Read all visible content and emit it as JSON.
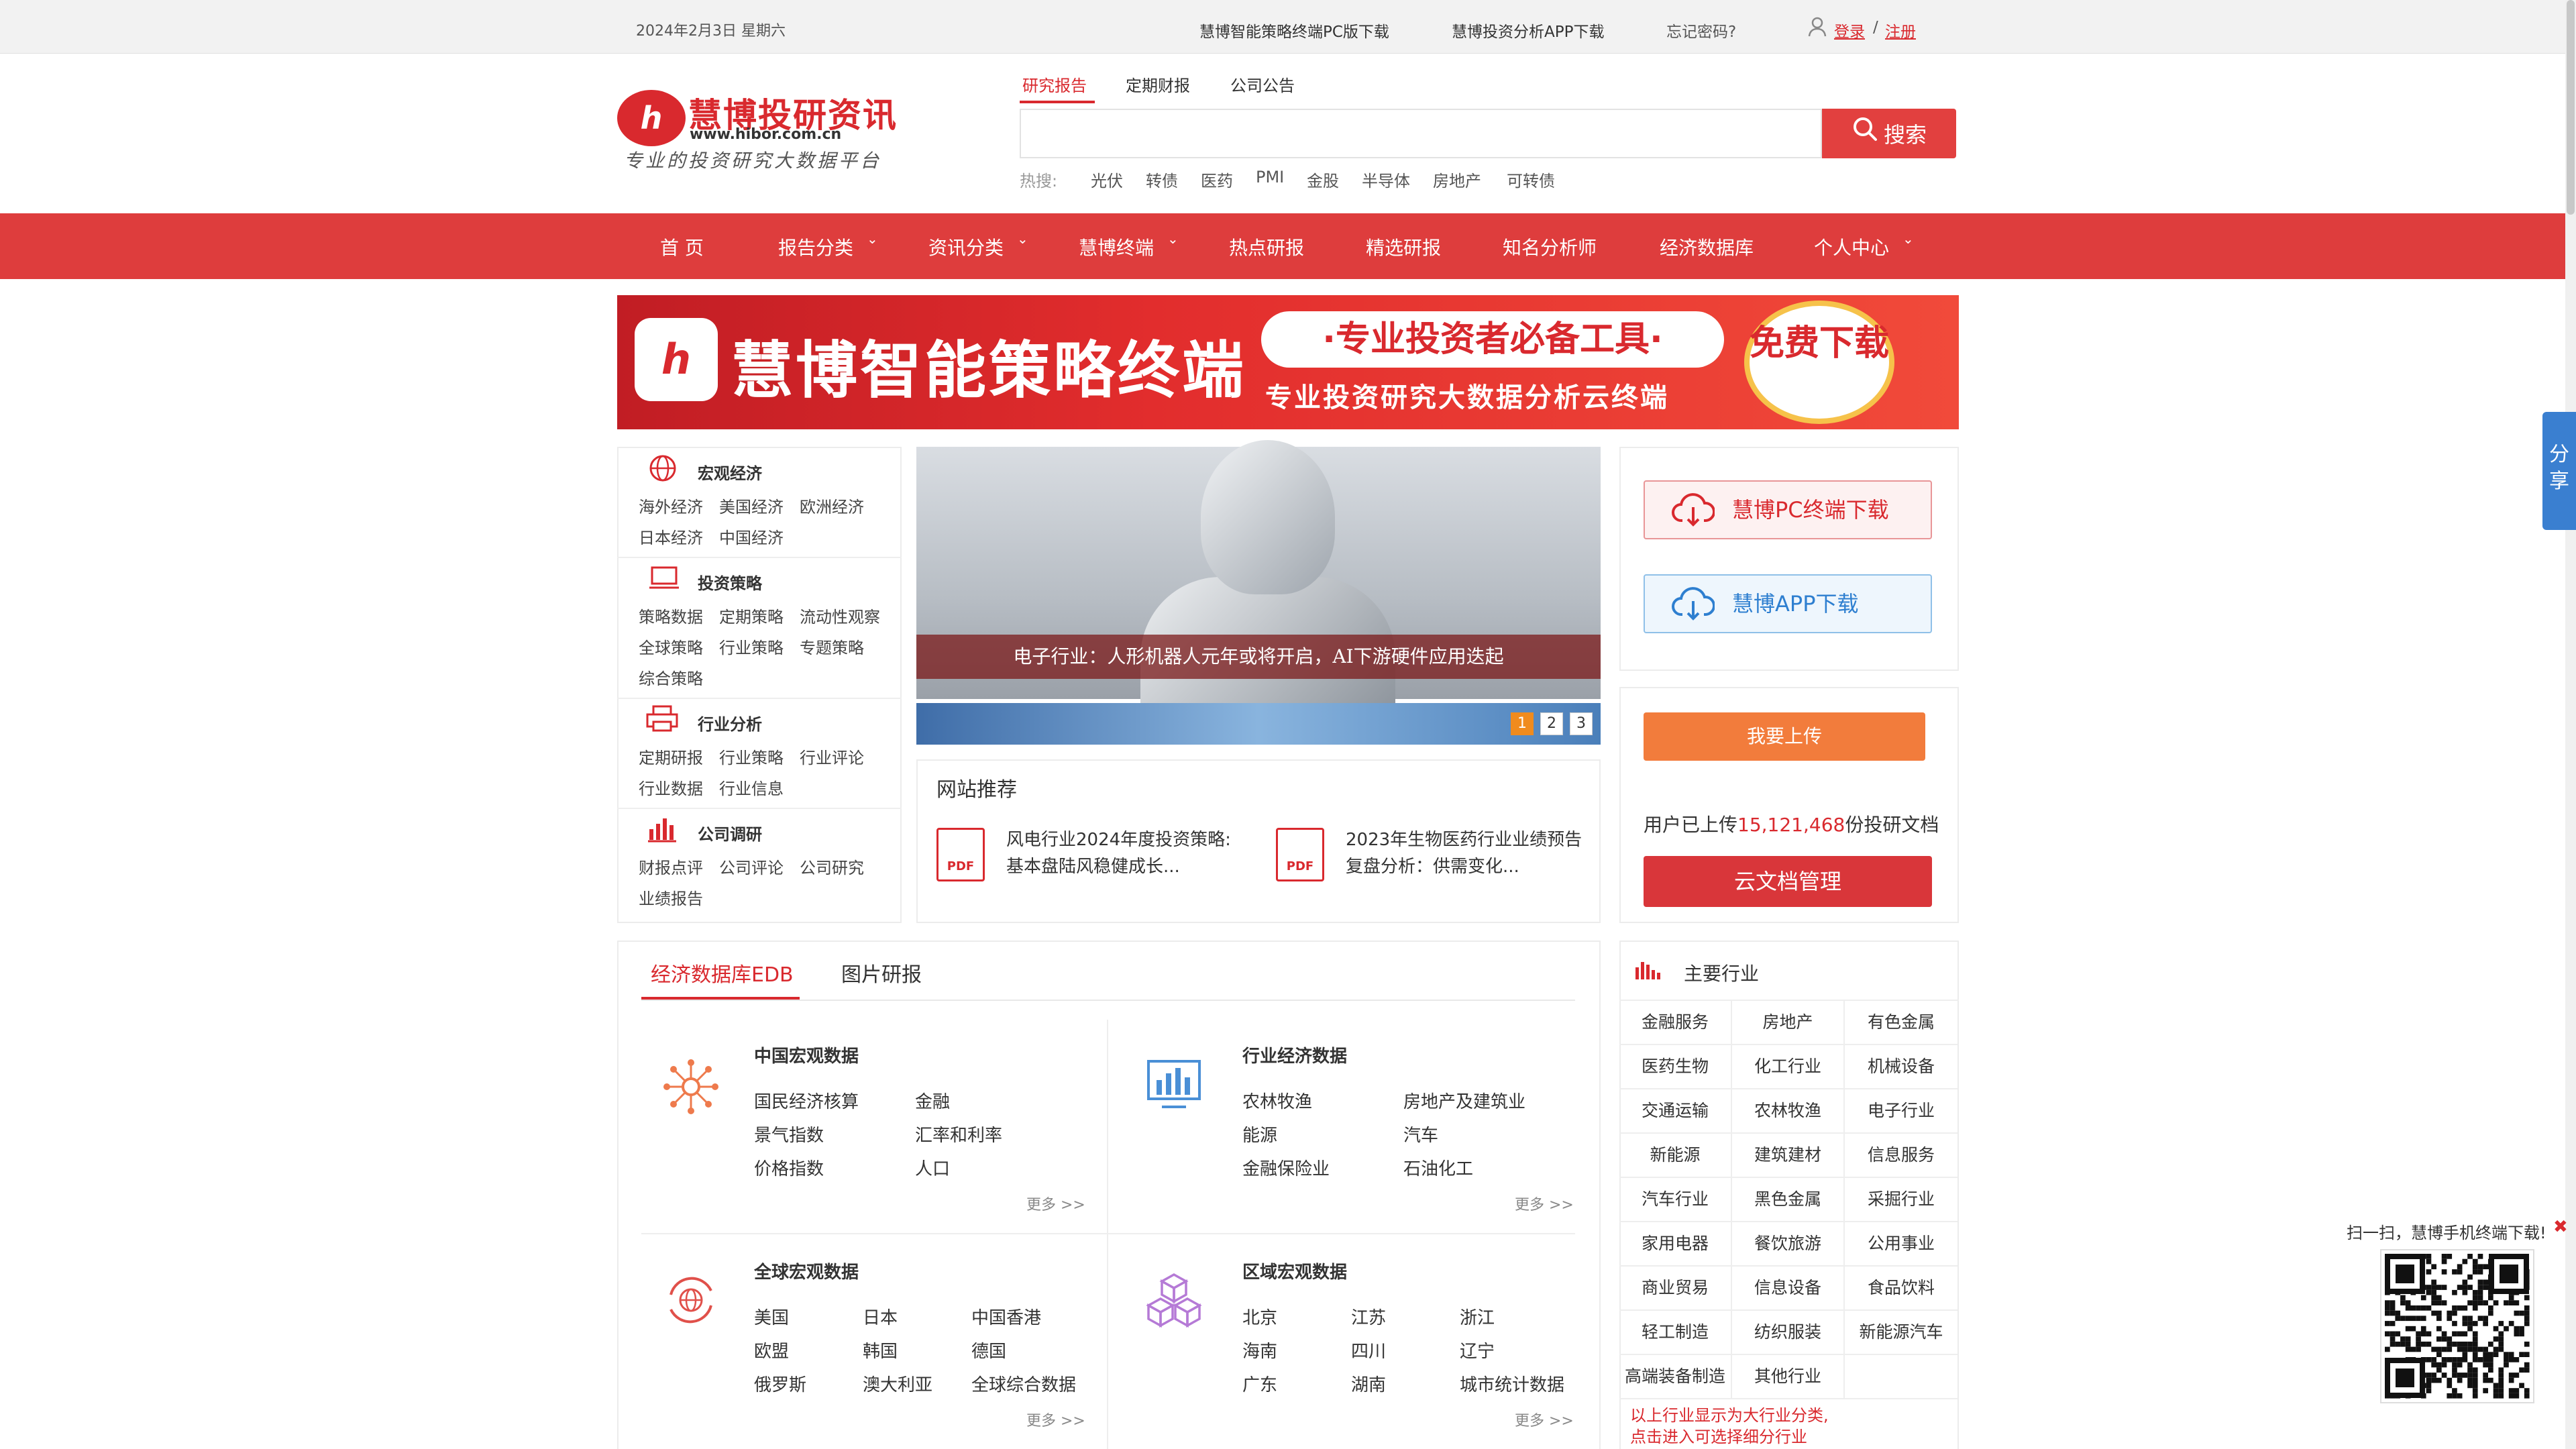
{
  "topbar": {
    "date": "2024年2月3日 星期六",
    "pc_download": "慧博智能策略终端PC版下载",
    "app_download": "慧博投资分析APP下载",
    "forgot": "忘记密码?",
    "login": "登录",
    "sep": "/",
    "register": "注册"
  },
  "logo": {
    "mark": "h",
    "name": "慧博投研资讯",
    "url": "www.hibor.com.cn",
    "slogan": "专业的投资研究大数据平台"
  },
  "search": {
    "tabs": [
      "研究报告",
      "定期财报",
      "公司公告"
    ],
    "button": "搜索",
    "hot_label": "热搜:",
    "hot_words": [
      "光伏",
      "转债",
      "医药",
      "PMI",
      "金股",
      "半导体",
      "房地产",
      "可转债"
    ]
  },
  "nav": {
    "items": [
      "首 页",
      "报告分类",
      "资讯分类",
      "慧博终端",
      "热点研报",
      "精选研报",
      "知名分析师",
      "经济数据库",
      "个人中心"
    ],
    "chevron": "⌄"
  },
  "banner": {
    "title": "慧博智能策略终端",
    "pill": "·专业投资者必备工具·",
    "sub": "专业投资研究大数据分析云终端",
    "free": "免费下载"
  },
  "categories": [
    {
      "title": "宏观经济",
      "links": [
        [
          "海外经济",
          "美国经济",
          "欧洲经济"
        ],
        [
          "日本经济",
          "中国经济"
        ]
      ]
    },
    {
      "title": "投资策略",
      "links": [
        [
          "策略数据",
          "定期策略",
          "流动性观察"
        ],
        [
          "全球策略",
          "行业策略",
          "专题策略"
        ],
        [
          "综合策略"
        ]
      ]
    },
    {
      "title": "行业分析",
      "links": [
        [
          "定期研报",
          "行业策略",
          "行业评论"
        ],
        [
          "行业数据",
          "行业信息"
        ]
      ]
    },
    {
      "title": "公司调研",
      "links": [
        [
          "财报点评",
          "公司评论",
          "公司研究"
        ],
        [
          "业绩报告"
        ]
      ]
    }
  ],
  "hero": {
    "caption": "电子行业：人形机器人元年或将开启，AI下游硬件应用迭起",
    "dots": [
      "1",
      "2",
      "3"
    ]
  },
  "recommend": {
    "title": "网站推荐",
    "items": [
      {
        "line1": "风电行业2024年度投资策略:",
        "line2": "基本盘陆风稳健成长..."
      },
      {
        "line1": "2023年生物医药行业业绩预告",
        "line2": "复盘分析：供需变化..."
      }
    ],
    "pdf": "PDF"
  },
  "downloads": {
    "pc": "慧博PC终端下载",
    "app": "慧博APP下载"
  },
  "upload": {
    "button": "我要上传",
    "prefix": "用户已上传",
    "count": "15,121,468",
    "suffix": "份投研文档",
    "cloud": "云文档管理"
  },
  "edb": {
    "tabs": [
      "经济数据库EDB",
      "图片研报"
    ],
    "more": "更多 >>",
    "blocks": [
      {
        "title": "中国宏观数据",
        "links": [
          "国民经济核算",
          "金融",
          "景气指数",
          "汇率和利率",
          "价格指数",
          "人口"
        ]
      },
      {
        "title": "行业经济数据",
        "links": [
          "农林牧渔",
          "房地产及建筑业",
          "能源",
          "汽车",
          "金融保险业",
          "石油化工"
        ]
      },
      {
        "title": "全球宏观数据",
        "links": [
          "美国",
          "日本",
          "中国香港",
          "欧盟",
          "韩国",
          "德国",
          "俄罗斯",
          "澳大利亚",
          "全球综合数据"
        ]
      },
      {
        "title": "区域宏观数据",
        "links": [
          "北京",
          "江苏",
          "浙江",
          "海南",
          "四川",
          "辽宁",
          "广东",
          "湖南",
          "城市统计数据"
        ]
      }
    ]
  },
  "industries": {
    "title": "主要行业",
    "cells": [
      "金融服务",
      "房地产",
      "有色金属",
      "医药生物",
      "化工行业",
      "机械设备",
      "交通运输",
      "农林牧渔",
      "电子行业",
      "新能源",
      "建筑建材",
      "信息服务",
      "汽车行业",
      "黑色金属",
      "采掘行业",
      "家用电器",
      "餐饮旅游",
      "公用事业",
      "商业贸易",
      "信息设备",
      "食品饮料",
      "轻工制造",
      "纺织服装",
      "新能源汽车",
      "高端装备制造",
      "其他行业",
      ""
    ],
    "note1": "以上行业显示为大行业分类,",
    "note2": "点击进入可选择细分行业"
  },
  "share": {
    "label": "分享"
  },
  "qr": {
    "text": "扫一扫，慧博手机终端下载!",
    "close": "✖"
  }
}
